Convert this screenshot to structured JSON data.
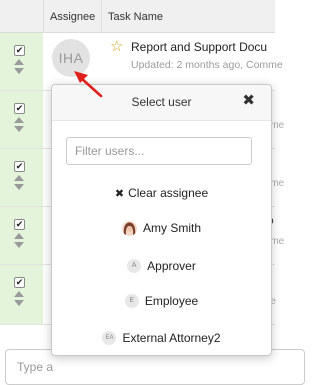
{
  "table": {
    "columns": {
      "assignee": "Assignee",
      "task_name": "Task Name"
    },
    "first_row": {
      "assignee_initials": "IHA",
      "title": "Report and Support Docu",
      "updated": "Updated: 2 months ago, Comme"
    },
    "peeks": [
      "&",
      "mme",
      "or",
      "mme",
      "so",
      "mme",
      "r",
      "me"
    ]
  },
  "popover": {
    "title": "Select user",
    "close_icon": "✖",
    "filter_placeholder": "Filter users...",
    "clear_icon": "✖",
    "clear_label": "Clear assignee",
    "users": [
      {
        "initials": "",
        "name": "Amy Smith",
        "avatar": "photo"
      },
      {
        "initials": "A",
        "name": "Approver"
      },
      {
        "initials": "E",
        "name": "Employee"
      },
      {
        "initials": "EA",
        "name": "External Attorney2"
      }
    ]
  },
  "comment": {
    "placeholder": "Type a"
  },
  "colors": {
    "selection_green": "#e3f4da",
    "star": "#d9a520",
    "arrow": "#e0201c"
  }
}
